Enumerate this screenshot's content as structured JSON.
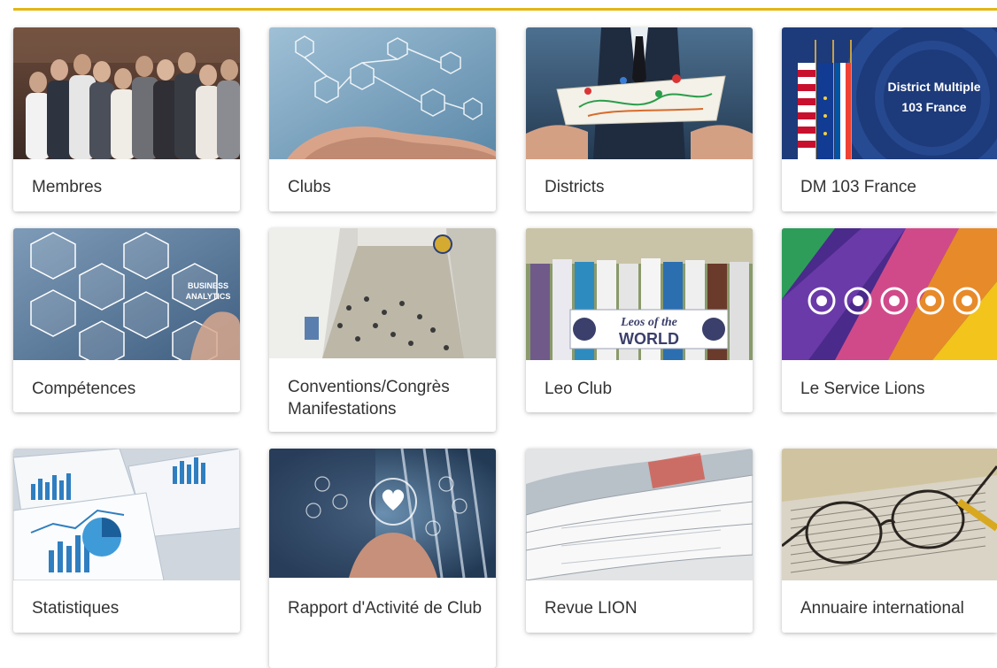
{
  "colors": {
    "accent_rule": "#e2b714",
    "label_text": "#333333"
  },
  "cards": [
    {
      "label": "Membres",
      "icon": "team-photo"
    },
    {
      "label": "Clubs",
      "icon": "network-hand-photo"
    },
    {
      "label": "Districts",
      "icon": "map-hands-photo"
    },
    {
      "label": "DM 103 France",
      "icon": "flags-photo",
      "overlay_text": "District Multiple 103 France"
    },
    {
      "label": "Compétences",
      "icon": "analytics-hexagons-photo"
    },
    {
      "label": "Conventions/Congrès Manifestations",
      "icon": "convention-hall-photo"
    },
    {
      "label": "Leo Club",
      "icon": "leo-parade-photo",
      "banner_text_1": "Leos of the",
      "banner_text_2": "WORLD"
    },
    {
      "label": "Le Service Lions",
      "icon": "service-causes-photo"
    },
    {
      "label": "Statistiques",
      "icon": "charts-papers-photo"
    },
    {
      "label": "Rapport d'Activité de Club",
      "icon": "heart-hands-photo"
    },
    {
      "label": "Revue LION",
      "icon": "magazines-photo"
    },
    {
      "label": "Annuaire international",
      "icon": "glasses-book-photo"
    }
  ]
}
